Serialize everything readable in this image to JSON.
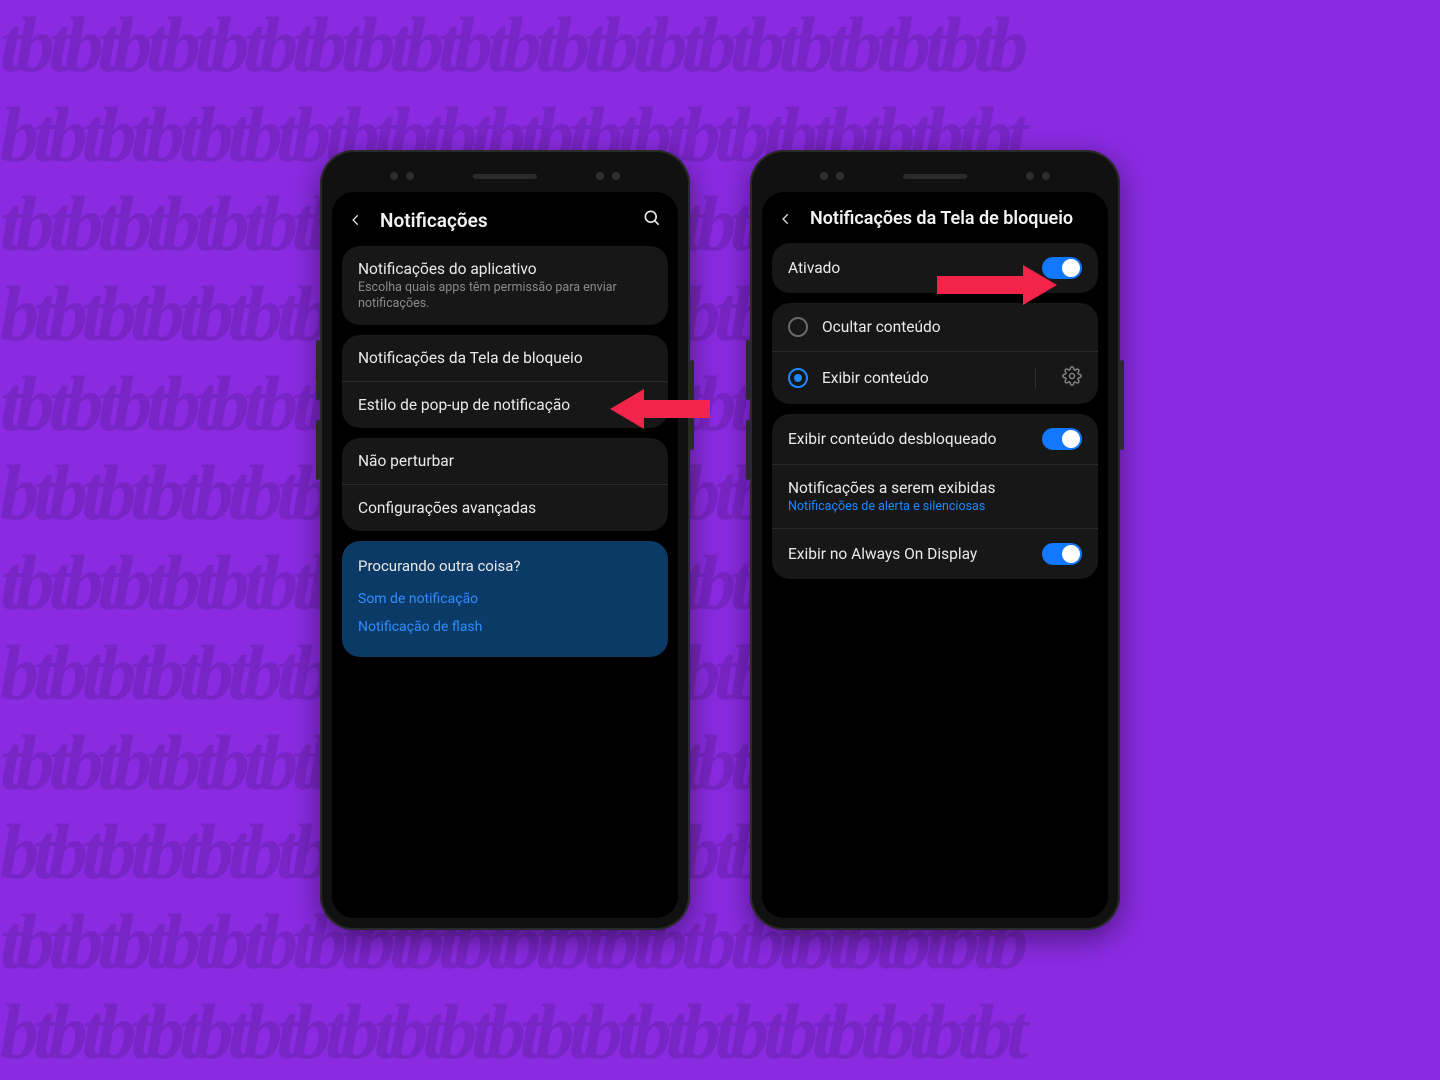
{
  "colors": {
    "bg": "#8a2be2",
    "accent": "#1e88ff",
    "arrow": "#f2244a"
  },
  "left": {
    "header_title": "Notificações",
    "app_notif_title": "Notificações do aplicativo",
    "app_notif_sub": "Escolha quais apps têm permissão para enviar notificações.",
    "lockscreen_notif": "Notificações da Tela de bloqueio",
    "popup_style": "Estilo de pop-up de notificação",
    "dnd": "Não perturbar",
    "advanced": "Configurações avançadas",
    "looking_for": "Procurando outra coisa?",
    "link_sound": "Som de notificação",
    "link_flash": "Notificação de flash"
  },
  "right": {
    "header_title": "Notificações da Tela de bloqueio",
    "enabled_label": "Ativado",
    "enabled": true,
    "radio_hide": "Ocultar conteúdo",
    "radio_show": "Exibir conteúdo",
    "radio_selected": "show",
    "show_unlocked": "Exibir conteúdo desbloqueado",
    "show_unlocked_on": true,
    "notifs_to_show": "Notificações a serem exibidas",
    "notifs_to_show_sub": "Notificações de alerta e silenciosas",
    "aod": "Exibir no Always On Display",
    "aod_on": true
  }
}
